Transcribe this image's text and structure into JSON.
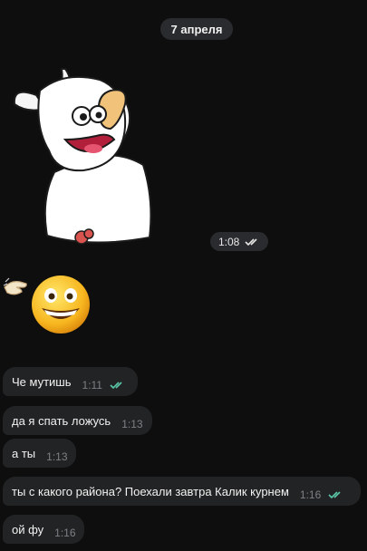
{
  "date_separator": "7 апреля",
  "sticker_message": {
    "time": "1:08",
    "status": "read"
  },
  "emoji_message": {
    "items": [
      "waving-hand-icon",
      "grinning-face-icon"
    ]
  },
  "messages": [
    {
      "text": "Че мутишь",
      "time": "1:11",
      "status": "read"
    },
    {
      "text": "да я спать ложусь",
      "time": "1:13"
    },
    {
      "text": "а ты",
      "time": "1:13"
    },
    {
      "text": "ты с какого района? Поехали завтра Калик курнем",
      "time": "1:16",
      "status": "read"
    },
    {
      "text": "ой фу",
      "time": "1:16"
    }
  ],
  "colors": {
    "background": "#0e0e0e",
    "bubble": "#222324",
    "pill": "#2a2b2e",
    "read_check": "#5ac8a8",
    "read_check_light": "#e6e6e6"
  }
}
